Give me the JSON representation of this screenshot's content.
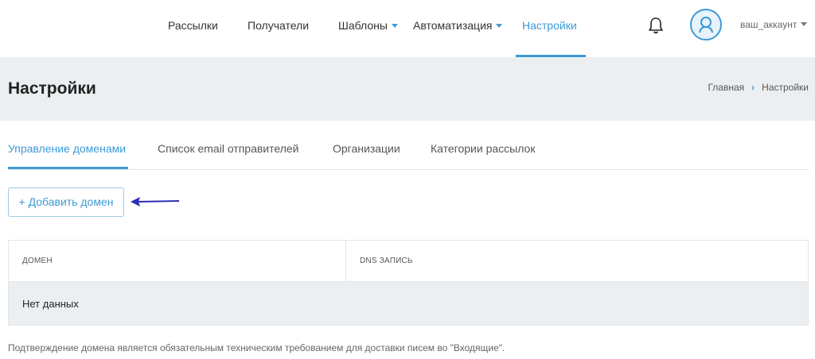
{
  "nav": {
    "items": [
      {
        "label": "Рассылки"
      },
      {
        "label": "Получатели"
      },
      {
        "label": "Шаблоны"
      },
      {
        "label": "Автоматизация"
      },
      {
        "label": "Настройки"
      }
    ],
    "account": "ваш_аккаунт",
    "accent": "#3c9ad6"
  },
  "header": {
    "title": "Настройки",
    "breadcrumb": {
      "home": "Главная",
      "separator": "›",
      "current": "Настройки"
    }
  },
  "tabs": [
    {
      "label": "Управление доменами",
      "active": true
    },
    {
      "label": "Список email отправителей"
    },
    {
      "label": "Организации"
    },
    {
      "label": "Категории рассылок"
    }
  ],
  "actions": {
    "add_domain": "+ Добавить домен"
  },
  "table": {
    "columns": [
      "ДОМЕН",
      "DNS ЗАПИСЬ"
    ],
    "empty_text": "Нет данных"
  },
  "note": "Подтверждение домена является обязательным техническим требованием для доставки писем во \"Входящие\"."
}
